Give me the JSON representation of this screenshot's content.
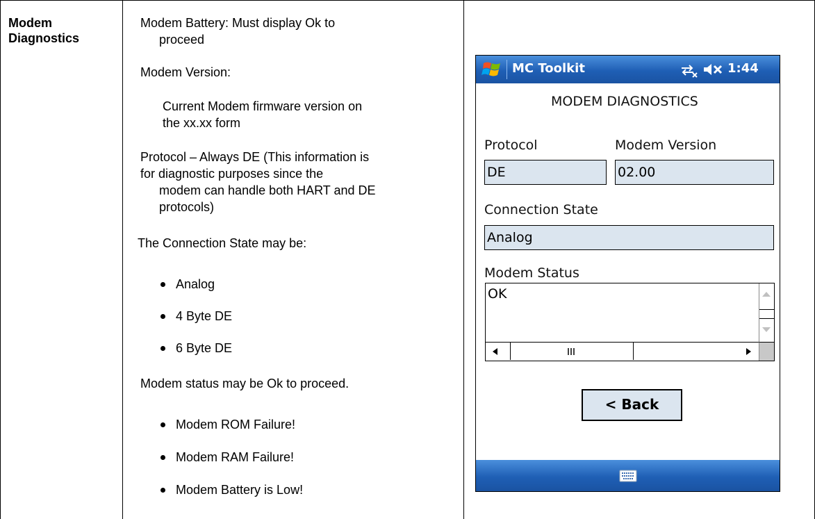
{
  "header": {
    "line1": "Modem",
    "line2": "Diagnostics"
  },
  "description": {
    "battery_line1": "Modem Battery: Must display Ok to",
    "battery_line2": "proceed",
    "version_label": "Modem Version:",
    "version_desc_line1": "Current Modem firmware version on",
    "version_desc_line2": "the xx.xx form",
    "protocol_line1": "Protocol – Always DE (This information is",
    "protocol_line2": "for diagnostic purposes since the",
    "protocol_line3": "modem can handle both HART and DE",
    "protocol_line4": "protocols)",
    "connection_intro": "The Connection State may be:",
    "connection_states": [
      "Analog",
      "4 Byte DE",
      "6 Byte DE"
    ],
    "status_intro": "Modem status may be Ok to proceed.",
    "status_values": [
      "Modem ROM Failure!",
      "Modem RAM Failure!",
      "Modem Battery is Low!"
    ]
  },
  "device": {
    "app_title": "MC Toolkit",
    "time": "1:44",
    "screen_title": "MODEM DIAGNOSTICS",
    "protocol_label": "Protocol",
    "protocol_value": "DE",
    "modem_version_label": "Modem Version",
    "modem_version_value": "02.00",
    "connection_state_label": "Connection State",
    "connection_state_value": "Analog",
    "modem_status_label": "Modem Status",
    "modem_status_value": "OK",
    "back_button": "< Back",
    "icons": [
      "windows-start-icon",
      "connectivity-icon",
      "speaker-muted-icon",
      "keyboard-icon"
    ],
    "colors": {
      "titlebar": "#1f5fb5",
      "field": "#dbe5ef"
    }
  }
}
